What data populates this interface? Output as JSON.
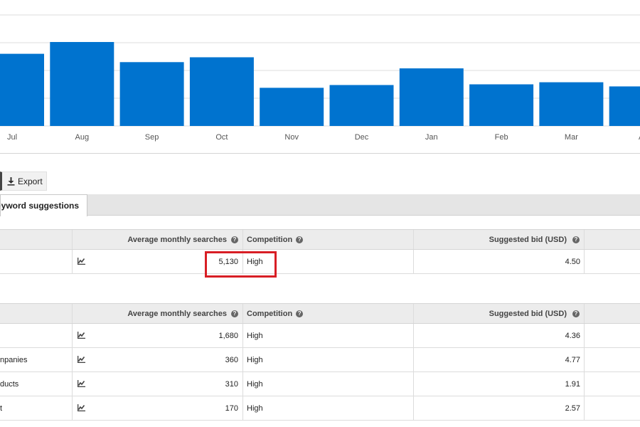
{
  "chart_data": {
    "type": "bar",
    "categories": [
      "Jul",
      "Aug",
      "Sep",
      "Oct",
      "Nov",
      "Dec",
      "Jan",
      "Feb",
      "Mar",
      "A"
    ],
    "values": [
      10400,
      12100,
      9200,
      9900,
      5500,
      5900,
      8300,
      6000,
      6300,
      5700
    ],
    "color": "#0073cf",
    "ylim": [
      0,
      16000
    ],
    "grid": true
  },
  "toolbar": {
    "export_label": "Export"
  },
  "tabs": {
    "active_label": "eyword suggestions"
  },
  "table_headers": {
    "avg": "Average monthly searches",
    "competition": "Competition",
    "bid": "Suggested bid (USD)"
  },
  "main_row": {
    "avg": "5,130",
    "competition": "High",
    "bid": "4.50"
  },
  "suggestion_rows": [
    {
      "keyword": "",
      "avg": "1,680",
      "competition": "High",
      "bid": "4.36"
    },
    {
      "keyword": "npanies",
      "avg": "360",
      "competition": "High",
      "bid": "4.77"
    },
    {
      "keyword": "ducts",
      "avg": "310",
      "competition": "High",
      "bid": "1.91"
    },
    {
      "keyword": "t",
      "avg": "170",
      "competition": "High",
      "bid": "2.57"
    }
  ],
  "icons": {
    "export": "download-icon",
    "help": "help-icon",
    "trend": "trend-chart-icon"
  }
}
